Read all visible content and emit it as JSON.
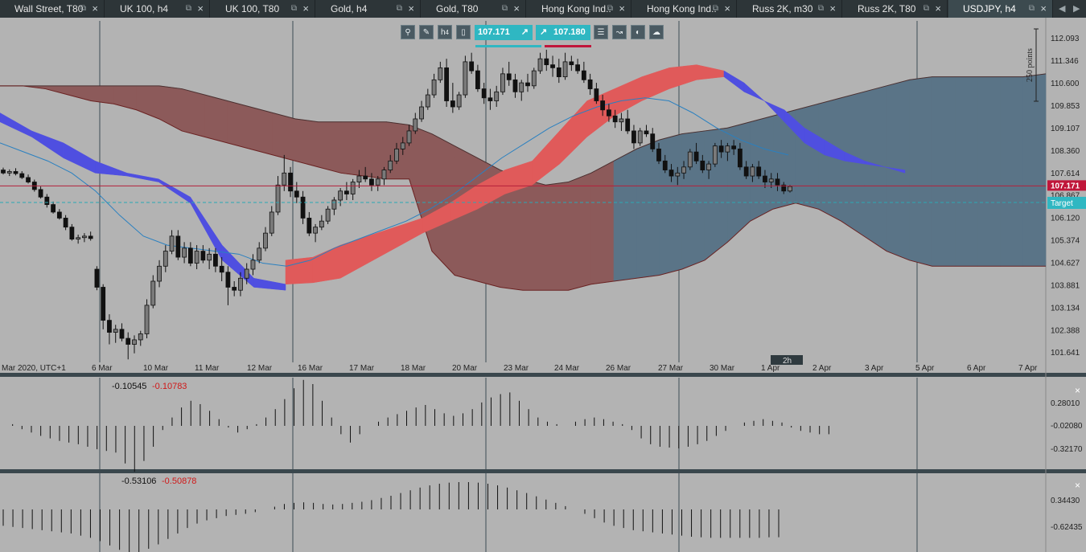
{
  "tabs": [
    {
      "label": "Wall Street, T80",
      "active": false
    },
    {
      "label": "UK 100, h4",
      "active": false
    },
    {
      "label": "UK 100, T80",
      "active": false
    },
    {
      "label": "Gold, h4",
      "active": false
    },
    {
      "label": "Gold, T80",
      "active": false
    },
    {
      "label": "Hong Kong Ind...",
      "active": false
    },
    {
      "label": "Hong Kong Ind...",
      "active": false
    },
    {
      "label": "Russ 2K, m30",
      "active": false
    },
    {
      "label": "Russ 2K, T80",
      "active": false
    },
    {
      "label": "USDJPY, h4",
      "active": true
    }
  ],
  "tab_icons": {
    "popout": "popout-icon",
    "close": "close-icon",
    "left": "chevron-left-icon",
    "right": "chevron-right-icon"
  },
  "toolbar": {
    "timeframe_label": "h",
    "timeframe_sub": "4",
    "sell_price": "107.171",
    "buy_price": "107.18",
    "buy_price_small": "0",
    "icons": [
      "zoom-icon",
      "drawing-tools-icon",
      "timeframe-icon",
      "candlestick-icon",
      "list-icon",
      "indicators-icon",
      "color-scheme-icon",
      "templates-icon"
    ]
  },
  "price_axis": {
    "labels": [
      "112.093",
      "111.346",
      "110.600",
      "109.853",
      "109.107",
      "108.360",
      "107.614",
      "106.867",
      "106.120",
      "105.374",
      "104.627",
      "103.881",
      "103.134",
      "102.388",
      "101.641"
    ],
    "current_price": "107.171",
    "target_label": "Target",
    "scale_label": "250 points"
  },
  "time_axis": {
    "labels": [
      "Mar 2020, UTC+1",
      "6 Mar",
      "10 Mar",
      "11 Mar",
      "12 Mar",
      "16 Mar",
      "17 Mar",
      "18 Mar",
      "20 Mar",
      "23 Mar",
      "24 Mar",
      "26 Mar",
      "27 Mar",
      "30 Mar",
      "1 Apr",
      "2 Apr",
      "3 Apr",
      "5 Apr",
      "6 Apr",
      "7 Apr"
    ],
    "interval_badge": "2h"
  },
  "indicator1": {
    "value_a": "-0.10545",
    "value_b": "-0.10783",
    "axis_labels": [
      "0.28010",
      "-0.02080",
      "-0.32170"
    ],
    "close_label": "×"
  },
  "indicator2": {
    "value_a": "-0.53106",
    "value_b": "-0.50878",
    "axis_labels": [
      "0.34430",
      "-0.62435"
    ],
    "close_label": "×"
  },
  "colors": {
    "background": "#b3b3b3",
    "tabbar": "#2d3538",
    "kumo_bearish": "#8c5a5a",
    "kumo_bullish": "#5a7487",
    "cloud_red": "#e05a5a",
    "cloud_blue": "#4f4fe0",
    "ma_line": "#2a80c0",
    "price_line": "#b5203a",
    "target_line": "#29a8b4",
    "accent_teal": "#2fb7c2",
    "accent_red": "#c0163a"
  },
  "chart_data": {
    "type": "candlestick",
    "symbol": "USDJPY",
    "timeframe": "h4",
    "ylim": [
      101.3,
      112.5
    ],
    "current_price": 107.171,
    "target_price": 106.62,
    "ohlc": [
      [
        107.7,
        107.78,
        107.55,
        107.6
      ],
      [
        107.6,
        107.72,
        107.5,
        107.65
      ],
      [
        107.65,
        107.76,
        107.52,
        107.58
      ],
      [
        107.58,
        107.66,
        107.4,
        107.45
      ],
      [
        107.45,
        107.55,
        107.25,
        107.3
      ],
      [
        107.3,
        107.38,
        106.98,
        107.05
      ],
      [
        107.05,
        107.15,
        106.75,
        106.8
      ],
      [
        106.8,
        106.9,
        106.45,
        106.55
      ],
      [
        106.55,
        106.65,
        106.25,
        106.3
      ],
      [
        106.3,
        106.4,
        106.05,
        106.1
      ],
      [
        106.1,
        106.2,
        105.7,
        105.8
      ],
      [
        105.8,
        105.9,
        105.35,
        105.4
      ],
      [
        105.4,
        105.55,
        105.25,
        105.45
      ],
      [
        105.45,
        105.6,
        105.3,
        105.5
      ],
      [
        105.5,
        105.65,
        105.35,
        105.42
      ],
      [
        104.4,
        104.5,
        103.7,
        103.8
      ],
      [
        103.8,
        103.9,
        102.4,
        102.7
      ],
      [
        102.7,
        102.9,
        101.9,
        102.3
      ],
      [
        102.3,
        102.55,
        101.95,
        102.4
      ],
      [
        102.4,
        102.6,
        102.0,
        102.1
      ],
      [
        102.1,
        102.3,
        101.4,
        101.9
      ],
      [
        101.9,
        102.2,
        101.6,
        102.05
      ],
      [
        102.05,
        102.35,
        101.85,
        102.25
      ],
      [
        102.25,
        103.4,
        102.1,
        103.2
      ],
      [
        103.2,
        104.2,
        103.1,
        104.0
      ],
      [
        104.0,
        104.7,
        103.8,
        104.5
      ],
      [
        104.5,
        105.2,
        104.3,
        105.0
      ],
      [
        105.0,
        105.7,
        104.9,
        105.5
      ],
      [
        105.5,
        105.7,
        104.7,
        104.8
      ],
      [
        104.8,
        105.3,
        104.6,
        105.1
      ],
      [
        105.1,
        105.3,
        104.5,
        104.6
      ],
      [
        104.6,
        105.2,
        104.4,
        105.0
      ],
      [
        105.0,
        105.2,
        104.6,
        104.7
      ],
      [
        104.7,
        105.1,
        104.4,
        104.9
      ],
      [
        104.9,
        105.1,
        104.3,
        104.5
      ],
      [
        104.5,
        104.8,
        104.0,
        104.3
      ],
      [
        104.3,
        104.5,
        103.2,
        103.8
      ],
      [
        103.8,
        104.0,
        103.5,
        103.7
      ],
      [
        103.7,
        104.3,
        103.5,
        104.1
      ],
      [
        104.1,
        104.6,
        103.9,
        104.4
      ],
      [
        104.4,
        104.9,
        104.2,
        104.7
      ],
      [
        104.7,
        105.3,
        104.6,
        105.1
      ],
      [
        105.1,
        105.8,
        105.0,
        105.6
      ],
      [
        105.6,
        106.5,
        105.5,
        106.3
      ],
      [
        106.3,
        107.5,
        106.2,
        107.2
      ],
      [
        107.2,
        108.2,
        107.0,
        107.6
      ],
      [
        107.6,
        107.8,
        106.8,
        107.0
      ],
      [
        107.0,
        107.3,
        106.6,
        106.8
      ],
      [
        106.8,
        107.0,
        105.9,
        106.1
      ],
      [
        106.1,
        106.3,
        105.5,
        105.6
      ],
      [
        105.6,
        105.9,
        105.3,
        105.8
      ],
      [
        105.8,
        106.2,
        105.7,
        106.0
      ],
      [
        106.0,
        106.5,
        105.9,
        106.4
      ],
      [
        106.4,
        106.8,
        106.2,
        106.7
      ],
      [
        106.7,
        107.1,
        106.5,
        107.0
      ],
      [
        107.0,
        107.3,
        106.7,
        106.9
      ],
      [
        106.9,
        107.4,
        106.7,
        107.3
      ],
      [
        107.3,
        107.7,
        107.1,
        107.5
      ],
      [
        107.5,
        107.8,
        107.3,
        107.4
      ],
      [
        107.4,
        107.6,
        107.0,
        107.2
      ],
      [
        107.2,
        107.5,
        107.0,
        107.4
      ],
      [
        107.4,
        107.8,
        107.2,
        107.7
      ],
      [
        107.7,
        108.2,
        107.6,
        108.0
      ],
      [
        108.0,
        108.6,
        107.9,
        108.4
      ],
      [
        108.4,
        108.8,
        108.2,
        108.6
      ],
      [
        108.6,
        109.2,
        108.5,
        109.0
      ],
      [
        109.0,
        109.6,
        108.9,
        109.4
      ],
      [
        109.4,
        110.0,
        109.3,
        109.8
      ],
      [
        109.8,
        110.4,
        109.7,
        110.2
      ],
      [
        110.2,
        110.9,
        110.1,
        110.7
      ],
      [
        110.7,
        111.3,
        110.6,
        111.1
      ],
      [
        111.1,
        111.4,
        109.8,
        110.0
      ],
      [
        110.0,
        110.6,
        109.6,
        109.8
      ],
      [
        109.8,
        110.3,
        109.7,
        110.2
      ],
      [
        110.2,
        111.5,
        110.1,
        111.3
      ],
      [
        111.3,
        111.6,
        110.9,
        111.0
      ],
      [
        111.0,
        111.2,
        110.3,
        110.4
      ],
      [
        110.4,
        110.6,
        109.9,
        110.1
      ],
      [
        110.1,
        110.4,
        109.7,
        110.0
      ],
      [
        110.0,
        110.5,
        109.8,
        110.3
      ],
      [
        110.3,
        111.1,
        110.2,
        110.9
      ],
      [
        110.9,
        111.3,
        110.5,
        110.7
      ],
      [
        110.7,
        110.9,
        110.1,
        110.3
      ],
      [
        110.3,
        110.7,
        110.0,
        110.6
      ],
      [
        110.6,
        110.9,
        110.3,
        110.5
      ],
      [
        110.5,
        111.1,
        110.4,
        111.0
      ],
      [
        111.0,
        111.6,
        110.9,
        111.4
      ],
      [
        111.4,
        111.7,
        111.0,
        111.2
      ],
      [
        111.2,
        111.5,
        110.8,
        111.1
      ],
      [
        111.1,
        111.4,
        110.6,
        110.8
      ],
      [
        110.8,
        111.6,
        110.7,
        111.3
      ],
      [
        111.3,
        111.5,
        111.0,
        111.2
      ],
      [
        111.2,
        111.4,
        110.9,
        111.0
      ],
      [
        111.0,
        111.3,
        110.6,
        110.7
      ],
      [
        110.7,
        110.9,
        110.2,
        110.4
      ],
      [
        110.4,
        110.6,
        109.9,
        110.0
      ],
      [
        110.0,
        110.2,
        109.5,
        109.7
      ],
      [
        109.7,
        109.9,
        109.3,
        109.5
      ],
      [
        109.5,
        109.7,
        109.1,
        109.3
      ],
      [
        109.3,
        109.6,
        109.0,
        109.4
      ],
      [
        109.4,
        109.7,
        108.9,
        109.0
      ],
      [
        109.0,
        109.2,
        108.4,
        108.6
      ],
      [
        108.6,
        109.1,
        108.5,
        109.0
      ],
      [
        109.0,
        109.2,
        108.8,
        108.9
      ],
      [
        108.9,
        109.1,
        108.3,
        108.4
      ],
      [
        108.4,
        108.6,
        107.9,
        108.0
      ],
      [
        108.0,
        108.2,
        107.6,
        107.7
      ],
      [
        107.7,
        107.9,
        107.3,
        107.5
      ],
      [
        107.5,
        107.8,
        107.2,
        107.6
      ],
      [
        107.6,
        108.0,
        107.4,
        107.8
      ],
      [
        107.8,
        108.4,
        107.7,
        108.3
      ],
      [
        108.3,
        108.6,
        107.9,
        108.0
      ],
      [
        108.0,
        108.2,
        107.6,
        107.7
      ],
      [
        107.7,
        108.0,
        107.4,
        107.9
      ],
      [
        107.9,
        108.6,
        107.8,
        108.5
      ],
      [
        108.5,
        108.7,
        108.1,
        108.3
      ],
      [
        108.3,
        108.6,
        108.0,
        108.5
      ],
      [
        108.5,
        108.7,
        108.2,
        108.4
      ],
      [
        108.4,
        108.6,
        107.7,
        107.8
      ],
      [
        107.8,
        108.0,
        107.4,
        107.5
      ],
      [
        107.5,
        107.9,
        107.3,
        107.8
      ],
      [
        107.8,
        108.0,
        107.4,
        107.5
      ],
      [
        107.5,
        107.7,
        107.1,
        107.3
      ],
      [
        107.3,
        107.6,
        107.1,
        107.4
      ],
      [
        107.4,
        107.6,
        107.0,
        107.2
      ],
      [
        107.2,
        107.3,
        106.9,
        107.0
      ],
      [
        107.0,
        107.2,
        106.95,
        107.15
      ]
    ],
    "kumo_upper": [
      110.5,
      110.5,
      110.5,
      110.5,
      110.5,
      110.5,
      110.5,
      110.5,
      110.4,
      110.2,
      110.0,
      109.8,
      109.6,
      109.4,
      109.3,
      109.3,
      109.3,
      109.3,
      109.2,
      108.9,
      108.5,
      108.1,
      107.7,
      107.4,
      107.2,
      107.3,
      107.6,
      108.0,
      108.4,
      108.7,
      108.9,
      109.0,
      109.1,
      109.3,
      109.5,
      109.7,
      109.9,
      110.1,
      110.3,
      110.5,
      110.7,
      110.8,
      110.8,
      110.8,
      110.8,
      110.8,
      110.9
    ],
    "kumo_lower": [
      110.5,
      110.5,
      110.4,
      110.2,
      110.0,
      109.9,
      109.7,
      109.4,
      109.0,
      108.8,
      108.6,
      108.4,
      108.2,
      108.0,
      107.8,
      107.6,
      107.5,
      107.4,
      107.4,
      105.0,
      104.2,
      104.0,
      103.8,
      103.7,
      103.7,
      103.7,
      103.9,
      104.0,
      104.1,
      104.2,
      104.4,
      104.7,
      105.3,
      106.0,
      106.4,
      106.6,
      106.4,
      106.0,
      105.5,
      105.0,
      104.7,
      104.5,
      104.5,
      104.5,
      104.5,
      104.5,
      104.5
    ],
    "red_cloud_upper": [
      104.7,
      104.8,
      105.2,
      105.5,
      105.8,
      106.1,
      106.6,
      107.2,
      107.7,
      108.0,
      109.0,
      110.0,
      110.4,
      110.8,
      111.1,
      111.2,
      111.0
    ],
    "red_cloud_lower": [
      103.9,
      103.95,
      104.1,
      104.6,
      105.1,
      105.6,
      106.0,
      106.4,
      106.9,
      107.2,
      107.9,
      108.8,
      109.5,
      110.0,
      110.4,
      110.7,
      110.8
    ],
    "moving_average": [
      108.6,
      108.3,
      108.0,
      107.6,
      107.0,
      106.2,
      105.5,
      105.2,
      105.1,
      105.0,
      104.9,
      104.6,
      104.5,
      104.7,
      105.1,
      105.4,
      105.7,
      106.0,
      106.4,
      106.9,
      107.5,
      108.1,
      108.6,
      109.1,
      109.5,
      109.8,
      110.0,
      110.1,
      110.0,
      109.6,
      109.1,
      108.7,
      108.4,
      108.2
    ],
    "indicator1_values": [
      0.0,
      0.02,
      -0.04,
      -0.08,
      -0.12,
      -0.15,
      -0.18,
      -0.2,
      -0.22,
      -0.25,
      -0.28,
      -0.3,
      -0.32,
      -0.45,
      -0.55,
      -0.42,
      -0.25,
      -0.05,
      0.1,
      0.22,
      0.3,
      0.26,
      0.18,
      0.08,
      -0.02,
      -0.08,
      -0.04,
      0.02,
      0.1,
      0.2,
      0.32,
      0.45,
      0.55,
      0.5,
      0.3,
      0.1,
      -0.1,
      -0.2,
      -0.1,
      0.0,
      0.05,
      0.1,
      0.14,
      0.18,
      0.22,
      0.25,
      0.2,
      0.15,
      0.12,
      0.15,
      0.2,
      0.28,
      0.34,
      0.38,
      0.4,
      0.3,
      0.2,
      0.1,
      0.05,
      0.02,
      0.0,
      0.05,
      0.08,
      0.1,
      0.08,
      0.05,
      0.02,
      -0.05,
      -0.15,
      -0.22,
      -0.25,
      -0.26,
      -0.27,
      -0.25,
      -0.22,
      -0.18,
      -0.12,
      -0.06,
      0.0,
      0.04,
      0.06,
      0.08,
      0.06,
      0.04,
      -0.02,
      -0.06,
      -0.08,
      -0.1,
      -0.1
    ],
    "indicator2_values": [
      -0.3,
      -0.32,
      -0.34,
      -0.36,
      -0.38,
      -0.4,
      -0.42,
      -0.44,
      -0.48,
      -0.52,
      -0.58,
      -0.66,
      -0.74,
      -0.8,
      -0.78,
      -0.72,
      -0.64,
      -0.54,
      -0.44,
      -0.34,
      -0.26,
      -0.2,
      -0.16,
      -0.12,
      -0.1,
      -0.08,
      -0.05,
      0.0,
      0.05,
      0.1,
      0.12,
      0.13,
      0.12,
      0.1,
      0.09,
      0.1,
      0.12,
      0.14,
      0.17,
      0.21,
      0.25,
      0.3,
      0.35,
      0.4,
      0.44,
      0.47,
      0.49,
      0.5,
      0.5,
      0.49,
      0.47,
      0.44,
      0.4,
      0.35,
      0.3,
      0.24,
      0.18,
      0.12,
      0.06,
      0.0,
      -0.08,
      -0.16,
      -0.24,
      -0.3,
      -0.34,
      -0.38,
      -0.4,
      -0.42,
      -0.44,
      -0.46,
      -0.48,
      -0.5,
      -0.51,
      -0.52,
      -0.52,
      -0.52,
      -0.52,
      -0.52,
      -0.52,
      -0.51,
      -0.51
    ]
  }
}
